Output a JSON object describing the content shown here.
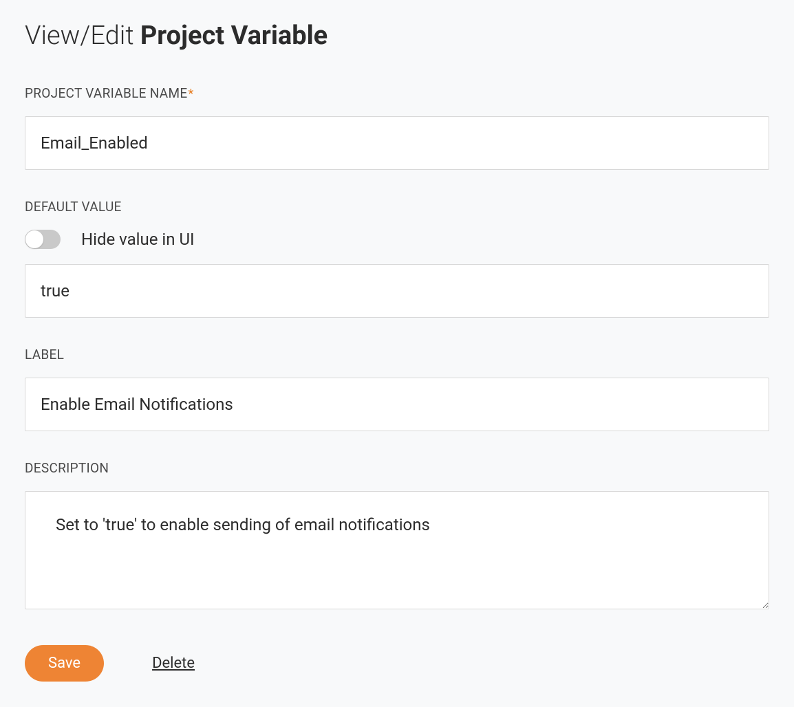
{
  "header": {
    "title_prefix": "View/Edit ",
    "title_bold": "Project Variable"
  },
  "fields": {
    "name": {
      "label": "PROJECT VARIABLE NAME",
      "required_marker": "*",
      "value": "Email_Enabled"
    },
    "default_value": {
      "label": "DEFAULT VALUE",
      "hide_toggle_label": "Hide value in UI",
      "hide_toggle_state": false,
      "value": "true"
    },
    "label_field": {
      "label": "LABEL",
      "value": "Enable Email Notifications"
    },
    "description": {
      "label": "DESCRIPTION",
      "value": "Set to 'true' to enable sending of email notifications"
    }
  },
  "actions": {
    "save_label": "Save",
    "delete_label": "Delete"
  }
}
